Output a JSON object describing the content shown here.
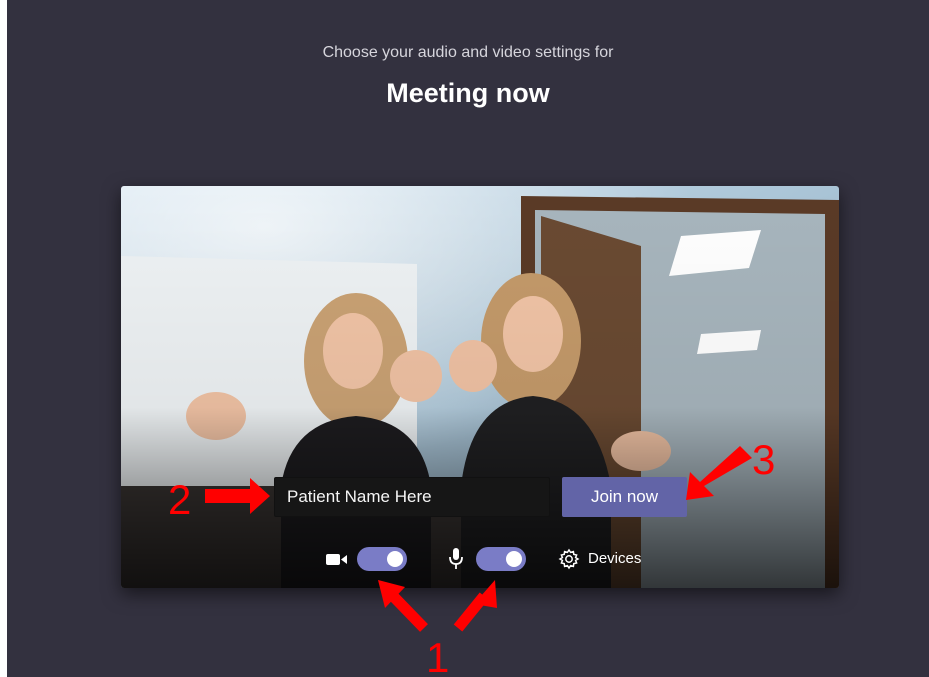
{
  "header": {
    "subtitle": "Choose your audio and video settings for",
    "meeting_title": "Meeting now"
  },
  "join_form": {
    "name_input_value": "",
    "name_input_placeholder": "Patient Name Here",
    "join_button_label": "Join now"
  },
  "controls": {
    "camera": {
      "icon": "video-camera-icon",
      "enabled": true
    },
    "microphone": {
      "icon": "microphone-icon",
      "enabled": true
    },
    "devices_label": "Devices",
    "devices_icon": "gear-icon"
  },
  "annotations": {
    "label_1": "1",
    "label_2": "2",
    "label_3": "3",
    "color": "#ff0000"
  },
  "colors": {
    "background": "#33313f",
    "accent": "#6264a7",
    "toggle_on": "#7a7cc6"
  }
}
